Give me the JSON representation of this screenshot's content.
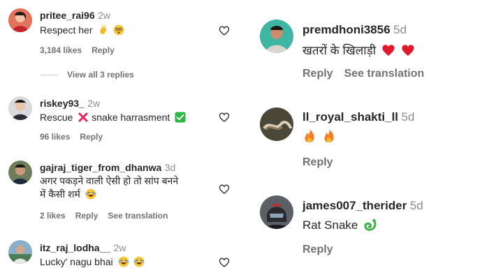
{
  "left_comments": [
    {
      "username": "pritee_rai96",
      "time": "2w",
      "text": "Respect her",
      "likes": "3,184 likes",
      "reply": "Reply"
    },
    {
      "username": "riskey93_",
      "time": "2w",
      "text_a": "Rescue",
      "text_b": "snake harrasment",
      "likes": "96 likes",
      "reply": "Reply"
    },
    {
      "username": "gajraj_tiger_from_dhanwa",
      "time": "3d",
      "text_line1": "अगर पकड़ने वाली ऐसी हो तो सांप बनने",
      "text_line2": "में कैसी शर्म",
      "likes": "2 likes",
      "reply": "Reply",
      "see_translation": "See translation"
    },
    {
      "username": "itz_raj_lodha__",
      "time": "2w",
      "text": "Lucky' nagu bhai"
    }
  ],
  "view_replies": "View all 3 replies",
  "right_comments": [
    {
      "username": "premdhoni3856",
      "time": "5d",
      "text": "खतरों के खिलाड़ी",
      "reply": "Reply",
      "see_translation": "See translation"
    },
    {
      "username": "ll_royal_shakti_ll",
      "time": "5d",
      "reply": "Reply"
    },
    {
      "username": "james007_therider",
      "time": "5d",
      "text": "Rat Snake",
      "reply": "Reply"
    }
  ],
  "icons": [
    "heart-outline-icon",
    "clap-emoji",
    "dizzy-face-emoji",
    "cross-mark-emoji",
    "check-mark-emoji",
    "laughing-face-emoji",
    "red-heart-emoji",
    "fire-emoji",
    "snake-emoji"
  ],
  "colors": {
    "accent_green": "#22c55e",
    "red": "#e1192b",
    "text": "#262626",
    "muted": "#737373"
  }
}
